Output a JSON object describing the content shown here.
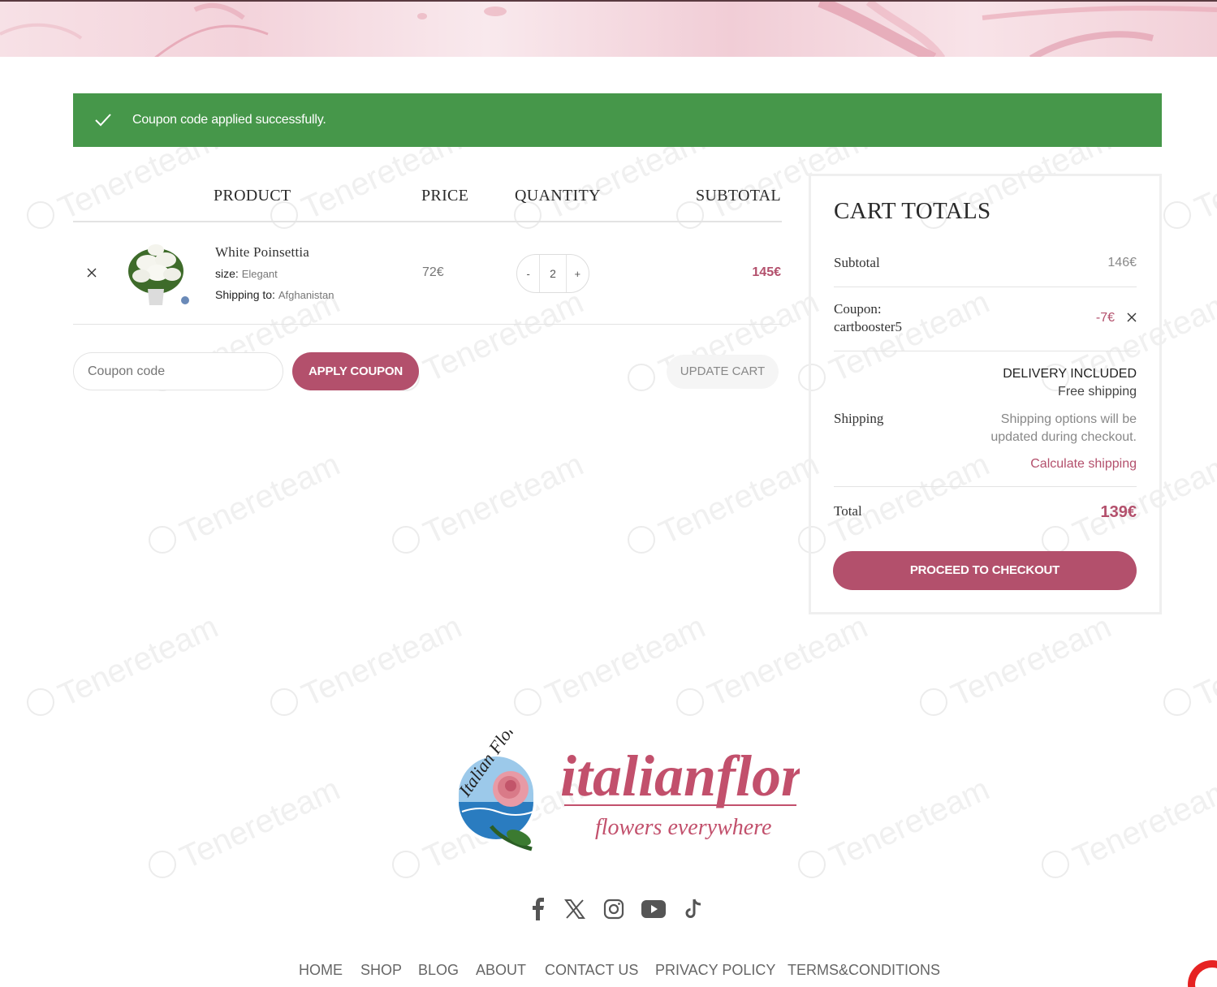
{
  "notice": {
    "message": "Coupon code applied successfully."
  },
  "table": {
    "headers": {
      "product": "PRODUCT",
      "price": "PRICE",
      "quantity": "QUANTITY",
      "subtotal": "SUBTOTAL"
    },
    "items": [
      {
        "name": "White Poinsettia",
        "size_label": "size:",
        "size_value": "Elegant",
        "shipping_label": "Shipping to:",
        "shipping_value": "Afghanistan",
        "price": "72€",
        "quantity": "2",
        "subtotal": "145€"
      }
    ],
    "qty_minus": "-",
    "qty_plus": "+"
  },
  "coupon": {
    "placeholder": "Coupon code",
    "apply_label": "APPLY COUPON"
  },
  "update_cart_label": "UPDATE CART",
  "totals": {
    "title": "CART TOTALS",
    "subtotal_label": "Subtotal",
    "subtotal_value": "146€",
    "coupon_label": "Coupon:",
    "coupon_code": "cartbooster5",
    "coupon_value": "-7€",
    "shipping_label": "Shipping",
    "delivery_title": "DELIVERY INCLUDED",
    "delivery_sub": "Free shipping",
    "shipping_note_1": "Shipping options will be",
    "shipping_note_2": "updated during checkout.",
    "calculate_shipping": "Calculate shipping",
    "total_label": "Total",
    "total_value": "139€",
    "checkout_label": "PROCEED TO CHECKOUT"
  },
  "footer": {
    "logo": {
      "wordmark": "italianflora",
      "tagline": "flowers everywhere",
      "badge_text": "Italian Flora"
    },
    "social": [
      "facebook-icon",
      "x-icon",
      "instagram-icon",
      "youtube-icon",
      "tiktok-icon"
    ],
    "nav": [
      "HOME",
      "SHOP",
      "BLOG",
      "ABOUT",
      "CONTACT US",
      "PRIVACY POLICY",
      "TERMS&CONDITIONS"
    ]
  },
  "watermark_text": "Tenereteam",
  "colors": {
    "accent": "#b3506c",
    "success": "#46974a",
    "border": "#e3e3e3"
  }
}
